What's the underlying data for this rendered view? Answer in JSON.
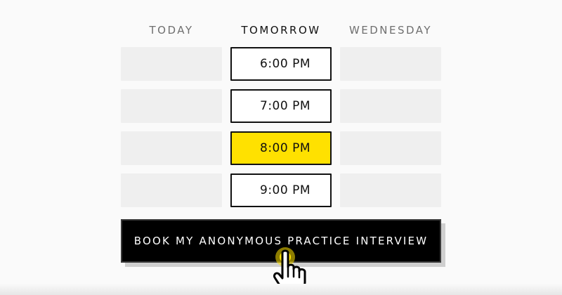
{
  "days": {
    "today": "TODAY",
    "tomorrow": "TOMORROW",
    "wednesday": "WEDNESDAY"
  },
  "slots": {
    "tomorrow": [
      "6:00 PM",
      "7:00 PM",
      "8:00 PM",
      "9:00 PM"
    ],
    "selected_index": 2
  },
  "book_button": {
    "label": "BOOK MY ANONYMOUS PRACTICE INTERVIEW"
  },
  "colors": {
    "accent": "#ffe100",
    "button_bg": "#000000",
    "empty_slot": "#efefef"
  },
  "icons": {
    "cursor": "hand-pointer-icon"
  }
}
